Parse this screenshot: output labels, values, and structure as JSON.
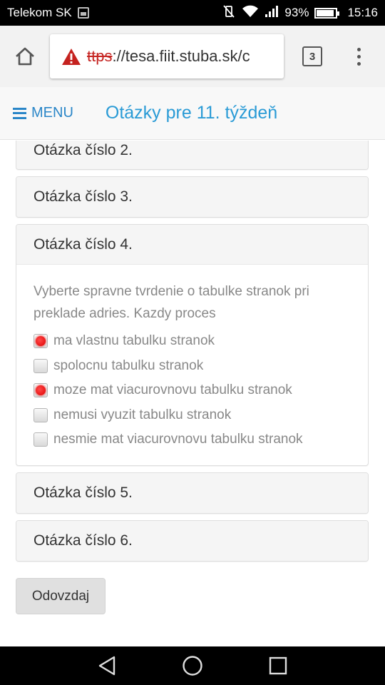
{
  "status_bar": {
    "carrier": "Telekom SK",
    "battery": "93%",
    "battery_level": 0.93,
    "time": "15:16"
  },
  "browser": {
    "url_scheme": "ttps",
    "url_rest": "://tesa.fiit.stuba.sk/c",
    "tab_count": "3"
  },
  "header": {
    "menu_label": "MENU",
    "title": "Otázky pre 11. týždeň"
  },
  "questions": [
    {
      "heading": "Otázka číslo 2."
    },
    {
      "heading": "Otázka číslo 3."
    },
    {
      "heading": "Otázka číslo 4.",
      "text": "Vyberte spravne tvrdenie o tabulke stranok pri preklade adries. Kazdy proces",
      "options": [
        {
          "label": "ma vlastnu tabulku stranok",
          "checked": true
        },
        {
          "label": "spolocnu tabulku stranok",
          "checked": false
        },
        {
          "label": "moze mat viacurovnovu tabulku stranok",
          "checked": true
        },
        {
          "label": "nemusi vyuzit tabulku stranok",
          "checked": false
        },
        {
          "label": "nesmie mat viacurovnovu tabulku stranok",
          "checked": false
        }
      ]
    },
    {
      "heading": "Otázka číslo 5."
    },
    {
      "heading": "Otázka číslo 6."
    }
  ],
  "submit_label": "Odovzdaj",
  "colors": {
    "accent": "#2a86c8",
    "title": "#2a9bd6",
    "warning": "#c5221f",
    "checked_marker": "#ff0000"
  }
}
